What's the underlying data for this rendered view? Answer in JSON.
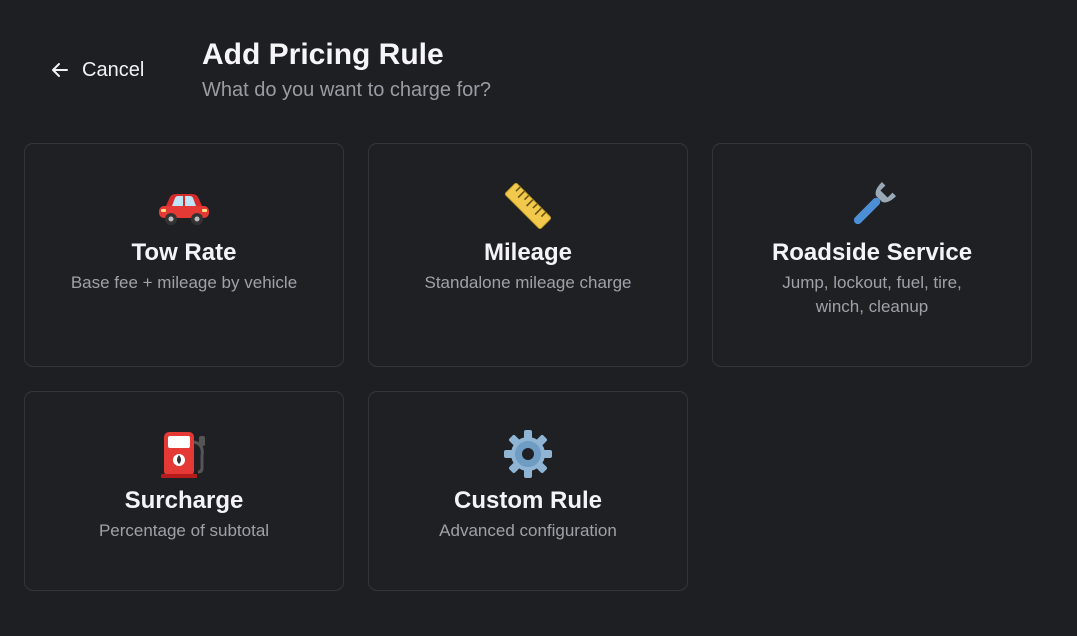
{
  "nav": {
    "cancel_label": "Cancel"
  },
  "header": {
    "title": "Add Pricing Rule",
    "subtitle": "What do you want to charge for?"
  },
  "cards": [
    {
      "icon": "car-icon",
      "title": "Tow Rate",
      "description": "Base fee + mileage by vehicle"
    },
    {
      "icon": "ruler-icon",
      "title": "Mileage",
      "description": "Standalone mileage charge"
    },
    {
      "icon": "wrench-icon",
      "title": "Roadside Service",
      "description": "Jump, lockout, fuel, tire, winch, cleanup"
    },
    {
      "icon": "fuel-pump-icon",
      "title": "Surcharge",
      "description": "Percentage of subtotal"
    },
    {
      "icon": "gear-icon",
      "title": "Custom Rule",
      "description": "Advanced configuration"
    }
  ],
  "colors": {
    "background": "#1e1f23",
    "card_border": "#34353b",
    "text_primary": "#f4f4f6",
    "text_secondary": "#a0a1a8"
  }
}
